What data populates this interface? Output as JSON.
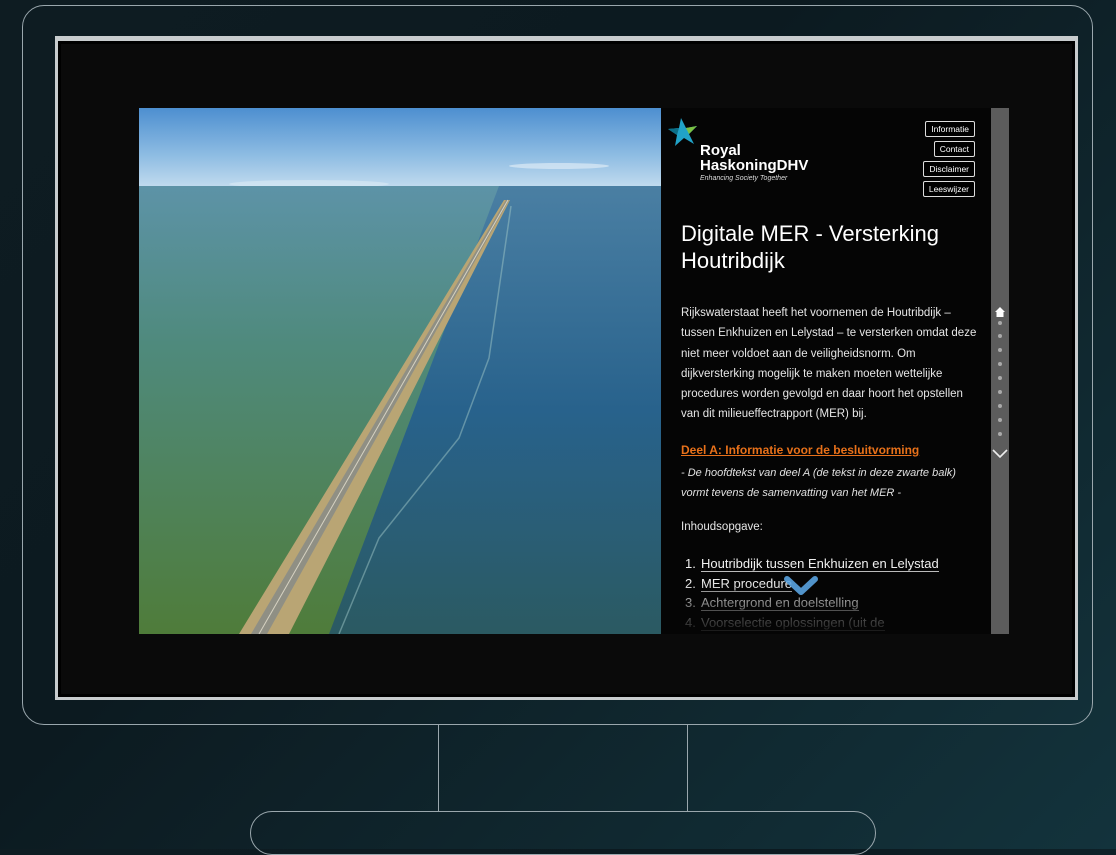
{
  "branding": {
    "line1": "Royal",
    "line2": "HaskoningDHV",
    "tagline": "Enhancing Society Together"
  },
  "nav": [
    {
      "label": "Informatie"
    },
    {
      "label": "Contact"
    },
    {
      "label": "Disclaimer"
    },
    {
      "label": "Leeswijzer"
    }
  ],
  "title": "Digitale MER - Versterking Houtribdijk",
  "intro": "Rijkswaterstaat heeft het voornemen de Houtribdijk – tussen Enkhuizen en Lelystad – te versterken omdat deze niet meer voldoet aan de veiligheidsnorm. Om dijkversterking mogelijk te maken moeten wettelijke procedures worden gevolgd en daar hoort het opstellen van dit milieueffectrapport (MER) bij.",
  "part": {
    "link": "Deel A: Informatie voor de besluitvorming",
    "note": "- De hoofdtekst van deel A (de tekst in deze zwarte balk) vormt tevens de samenvatting van het MER -"
  },
  "toc": {
    "heading": "Inhoudsopgave:",
    "items": [
      {
        "num": "1.",
        "label": "Houtribdijk tussen Enkhuizen en Lelystad"
      },
      {
        "num": "2.",
        "label": "MER procedure"
      },
      {
        "num": "3.",
        "label": "Achtergrond en doelstelling"
      },
      {
        "num": "4.",
        "label": "Voorselectie oplossingen (uit de"
      }
    ]
  },
  "colors": {
    "accent_link": "#e8711a",
    "rail": "#5c5c5c",
    "panel_bg": "#050505"
  },
  "icons": {
    "rail_home": "home-icon",
    "rail_down": "chevron-down-icon",
    "scroll_down": "chevron-down-icon"
  }
}
